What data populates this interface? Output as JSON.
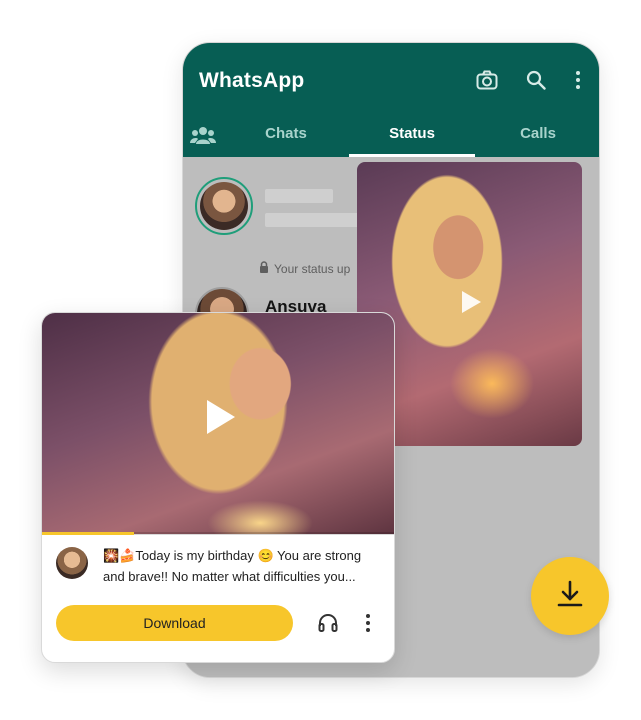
{
  "app": {
    "title": "WhatsApp"
  },
  "tabs": [
    {
      "label": "Chats",
      "active": false
    },
    {
      "label": "Status",
      "active": true
    },
    {
      "label": "Calls",
      "active": false
    }
  ],
  "status_list": {
    "lock_notice": "Your status up",
    "contact_name": "Ansuva"
  },
  "card": {
    "caption_line1": "Today is my birthday 😊 You are strong",
    "caption_line2": "and brave!! No matter what difficulties you...",
    "download_label": "Download",
    "progress": 0.26
  },
  "colors": {
    "brand": "#075e54",
    "accent": "#f7c62b"
  },
  "icons": [
    "camera-icon",
    "search-icon",
    "more-vert-icon",
    "communities-icon",
    "lock-icon",
    "play-icon",
    "headphones-icon",
    "download-icon"
  ]
}
